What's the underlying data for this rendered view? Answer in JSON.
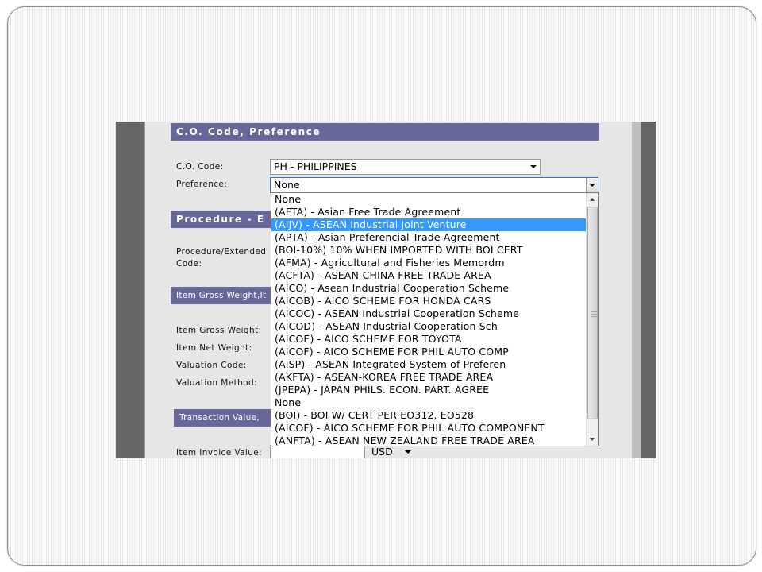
{
  "sections": {
    "co_code_preference": "C.O. Code, Preference",
    "procedure": "Procedure - E",
    "item_gross_weight": "Item Gross Weight,It",
    "transaction_value": "Transaction Value, "
  },
  "fields": {
    "co_code_label": "C.O. Code:",
    "co_code_value": "PH - PHILIPPINES",
    "preference_label": "Preference:",
    "preference_value": "None",
    "procedure_label_1": "Procedure/Extended",
    "procedure_label_2": "Code:",
    "item_gross_weight_label": "Item Gross Weight:",
    "item_net_weight_label": "Item Net Weight:",
    "valuation_code_label": "Valuation Code:",
    "valuation_method_label": "Valuation Method:",
    "item_invoice_value_label": "Item Invoice Value:",
    "currency_value": "USD"
  },
  "dropdown": {
    "selected_index": 2,
    "options": [
      "None",
      "(AFTA) - Asian Free Trade Agreement",
      "(AIJV) - ASEAN Industrial Joint Venture",
      "(APTA) - Asian Preferencial Trade Agreement",
      "(BOI-10%) 10% WHEN IMPORTED WITH BOI CERT",
      "(AFMA) - Agricultural and Fisheries Memordm",
      "(ACFTA) - ASEAN-CHINA FREE TRADE AREA",
      "(AICO) - Asean Industrial Cooperation Scheme",
      "(AICOB) - AICO SCHEME FOR HONDA CARS",
      "(AICOC) - ASEAN Industrial Cooperation Scheme",
      "(AICOD) - ASEAN Industrial Cooperation Sch",
      "(AICOE) - AICO SCHEME FOR TOYOTA",
      "(AICOF) - AICO SCHEME FOR PHIL AUTO COMP",
      "(AISP) - ASEAN Integrated System of Preferen",
      "(AKFTA) - ASEAN-KOREA FREE TRADE AREA",
      "(JPEPA) - JAPAN PHILS. ECON. PART. AGREE",
      "None",
      "(BOI) - BOI W/ CERT PER EO312, EO528",
      "(AICOF) - AICO SCHEME FOR PHIL AUTO COMPONENT",
      "(ANFTA) - ASEAN NEW ZEALAND FREE TRADE AREA"
    ]
  }
}
